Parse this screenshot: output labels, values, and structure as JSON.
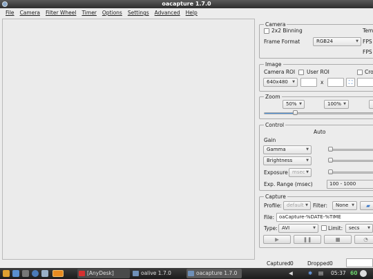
{
  "window": {
    "title": "oacapture 1.7.0"
  },
  "menu": [
    "File",
    "Camera",
    "Filter Wheel",
    "Timer",
    "Options",
    "Settings",
    "Advanced",
    "Help"
  ],
  "camera": {
    "title": "Camera",
    "binning_label": "2x2 Binning",
    "temp_label": "Tem",
    "frame_format_label": "Frame Format",
    "frame_format_value": "RGB24",
    "fps_label1": "FPS",
    "fps_label2": "FPS"
  },
  "image": {
    "title": "Image",
    "camera_roi_label": "Camera ROI",
    "user_roi_label": "User ROI",
    "crop_label": "Crop",
    "roi_value": "640x480",
    "x_label": "x"
  },
  "zoom": {
    "title": "Zoom",
    "zoom1": "50%",
    "zoom2": "100%",
    "slider_level": 0.28
  },
  "control": {
    "title": "Control",
    "auto_label": "Auto",
    "gain_label": "Gain",
    "gamma": "Gamma",
    "brightness": "Brightness",
    "exposure_label": "Exposure",
    "exposure_unit": "msec",
    "exp_range_label": "Exp. Range (msec)",
    "exp_range_value": "100 - 1000"
  },
  "capture": {
    "title": "Capture",
    "profile_label": "Profile:",
    "profile_value": "default",
    "filter_label": "Filter:",
    "filter_value": "None",
    "file_label": "File:",
    "file_value": "oaCapture-%DATE-%TIME",
    "type_label": "Type:",
    "type_value": "AVI",
    "limit_label": "Limit:",
    "limit_unit": "secs"
  },
  "status": {
    "captured_label": "Captured",
    "captured_value": "0",
    "dropped_label": "Dropped",
    "dropped_value": "0"
  },
  "taskbar": {
    "tasks": [
      "[AnyDesk]",
      "oalive 1.7.0",
      "oacapture 1.7.0"
    ],
    "clock": "05:37",
    "battery": "60"
  }
}
